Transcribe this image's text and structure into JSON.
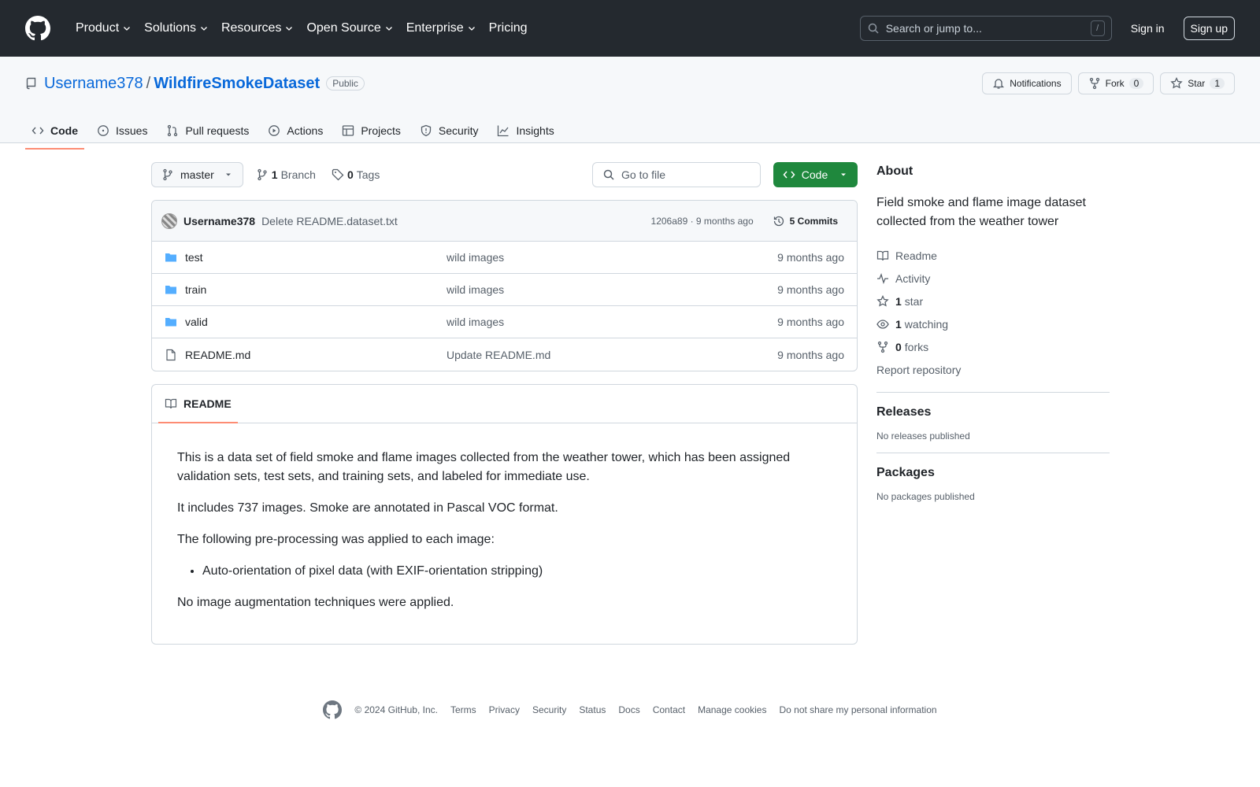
{
  "header": {
    "nav": [
      {
        "label": "Product",
        "dropdown": true
      },
      {
        "label": "Solutions",
        "dropdown": true
      },
      {
        "label": "Resources",
        "dropdown": true
      },
      {
        "label": "Open Source",
        "dropdown": true
      },
      {
        "label": "Enterprise",
        "dropdown": true
      },
      {
        "label": "Pricing",
        "dropdown": false
      }
    ],
    "search_placeholder": "Search or jump to...",
    "search_shortcut": "/",
    "signin": "Sign in",
    "signup": "Sign up"
  },
  "repo": {
    "owner": "Username378",
    "separator": "/",
    "name": "WildfireSmokeDataset",
    "visibility": "Public",
    "notifications": "Notifications",
    "fork_label": "Fork",
    "fork_count": "0",
    "star_label": "Star",
    "star_count": "1"
  },
  "tabs": [
    {
      "label": "Code",
      "icon": "code-icon",
      "active": true
    },
    {
      "label": "Issues",
      "icon": "issue-icon",
      "active": false
    },
    {
      "label": "Pull requests",
      "icon": "pull-request-icon",
      "active": false
    },
    {
      "label": "Actions",
      "icon": "play-icon",
      "active": false
    },
    {
      "label": "Projects",
      "icon": "table-icon",
      "active": false
    },
    {
      "label": "Security",
      "icon": "shield-icon",
      "active": false
    },
    {
      "label": "Insights",
      "icon": "graph-icon",
      "active": false
    }
  ],
  "filebar": {
    "branch": "master",
    "branch_count": "1",
    "branch_label": "Branch",
    "tag_count": "0",
    "tag_label": "Tags",
    "goto_placeholder": "Go to file",
    "code_button": "Code"
  },
  "commit": {
    "author": "Username378",
    "message": "Delete README.dataset.txt",
    "sha_time": "1206a89 · 9 months ago",
    "commits": "5 Commits"
  },
  "files": [
    {
      "name": "test",
      "type": "folder",
      "message": "wild images",
      "age": "9 months ago"
    },
    {
      "name": "train",
      "type": "folder",
      "message": "wild images",
      "age": "9 months ago"
    },
    {
      "name": "valid",
      "type": "folder",
      "message": "wild images",
      "age": "9 months ago"
    },
    {
      "name": "README.md",
      "type": "file",
      "message": "Update README.md",
      "age": "9 months ago"
    }
  ],
  "readme": {
    "tab": "README",
    "p1": "This is a data set of field smoke and flame images collected from the weather tower, which has been assigned validation sets, test sets, and training sets, and labeled for immediate use.",
    "p2": "It includes 737 images. Smoke are annotated in Pascal VOC format.",
    "p3": "The following pre-processing was applied to each image:",
    "li1": "Auto-orientation of pixel data (with EXIF-orientation stripping)",
    "p4": "No image augmentation techniques were applied."
  },
  "about": {
    "heading": "About",
    "description": "Field smoke and flame image dataset collected from the weather tower",
    "readme": "Readme",
    "activity": "Activity",
    "stars_count": "1",
    "stars_label": "star",
    "watching_count": "1",
    "watching_label": "watching",
    "forks_count": "0",
    "forks_label": "forks",
    "report": "Report repository"
  },
  "releases": {
    "heading": "Releases",
    "note": "No releases published"
  },
  "packages": {
    "heading": "Packages",
    "note": "No packages published"
  },
  "footer": {
    "copyright": "© 2024 GitHub, Inc.",
    "links": [
      "Terms",
      "Privacy",
      "Security",
      "Status",
      "Docs",
      "Contact",
      "Manage cookies",
      "Do not share my personal information"
    ]
  }
}
